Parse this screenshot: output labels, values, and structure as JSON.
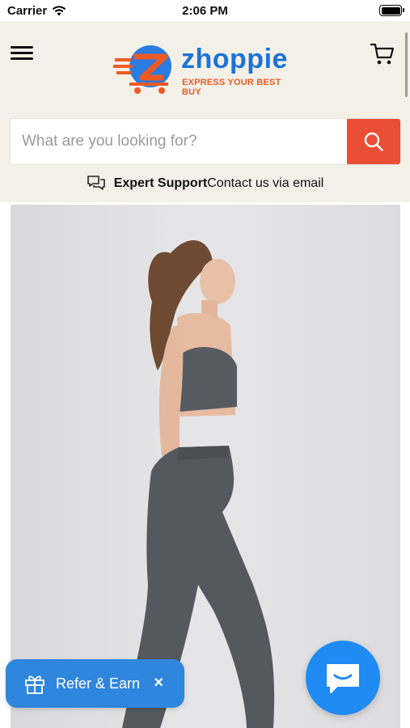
{
  "status": {
    "carrier": "Carrier",
    "time": "2:06 PM"
  },
  "header": {
    "brand": "zhoppie",
    "tagline": "EXPRESS YOUR BEST BUY",
    "colors": {
      "brand_blue": "#1e73d6",
      "brand_orange": "#ef5a24"
    }
  },
  "search": {
    "placeholder": "What are you looking for?",
    "value": "",
    "button_color": "#ea4e35"
  },
  "support": {
    "title": "Expert Support",
    "text": "Contact us via email"
  },
  "refer": {
    "label": "Refer & Earn",
    "close": "×"
  },
  "icons": {
    "menu": "hamburger-icon",
    "cart": "cart-icon",
    "search": "search-icon",
    "support": "chat-bubbles-icon",
    "gift": "gift-icon",
    "chat": "chat-icon"
  }
}
